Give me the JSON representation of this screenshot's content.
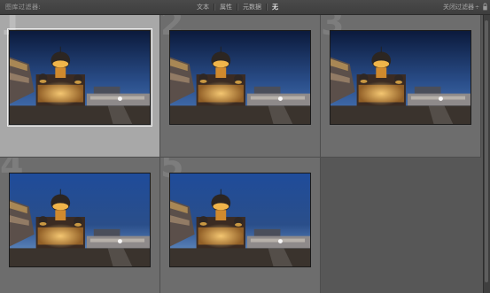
{
  "filter_bar": {
    "title": "图库过滤器:",
    "tabs": [
      {
        "label": "文本"
      },
      {
        "label": "属性"
      },
      {
        "label": "元数据"
      },
      {
        "label": "无"
      }
    ],
    "preset_label": "关闭过滤器",
    "preset_caret": "÷"
  },
  "grid": {
    "cells": [
      {
        "index": "1",
        "selected": true
      },
      {
        "index": "2",
        "selected": false
      },
      {
        "index": "3",
        "selected": false
      },
      {
        "index": "4",
        "selected": false
      },
      {
        "index": "5",
        "selected": false
      }
    ]
  },
  "colors": {
    "sky_top": "#0b1a3c",
    "sky_mid": "#2a4e8a",
    "sky_horizon": "#4d7bbb",
    "sky_bright_top": "#1f4c9a",
    "sky_bright_horizon": "#79a5d8",
    "building_glow": "#d98a2b",
    "ground": "#3a332d"
  },
  "icons": {
    "lock": "lock-icon",
    "caret": "chevron-down-icon"
  }
}
